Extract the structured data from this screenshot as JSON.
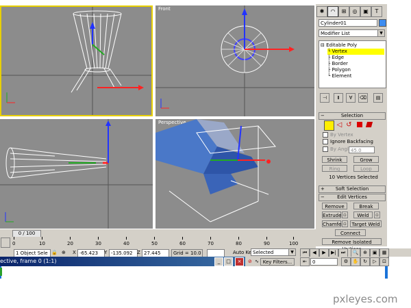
{
  "viewports": {
    "front_label": "Front",
    "perspective_label": "Perspective"
  },
  "panel": {
    "tabs": [
      "create-icon",
      "modify-icon",
      "hierarchy-icon",
      "motion-icon",
      "display-icon",
      "utilities-icon"
    ],
    "object_name": "Cylinder01",
    "modifier_list": "Modifier List",
    "stack": [
      "Editable Poly",
      "Vertex",
      "Edge",
      "Border",
      "Polygon",
      "Element"
    ],
    "selection": {
      "title": "Selection",
      "by_vertex": "By Vertex",
      "ignore_backfacing": "Ignore Backfacing",
      "by_angle": "By Angle:",
      "angle_value": "45.0",
      "shrink": "Shrink",
      "grow": "Grow",
      "ring": "Ring",
      "loop": "Loop",
      "status": "10 Vertices Selected"
    },
    "soft_selection": {
      "title": "Soft Selection"
    },
    "edit_vertices": {
      "title": "Edit Vertices",
      "remove": "Remove",
      "break": "Break",
      "extrude": "Extrude",
      "weld": "Weld",
      "chamfer": "Chamfer",
      "target_weld": "Target Weld",
      "connect": "Connect",
      "remove_isolated": "Remove Isolated Vertices"
    }
  },
  "timeline": {
    "frame_counter": "0 / 100",
    "ticks": [
      "0",
      "10",
      "20",
      "30",
      "40",
      "50",
      "60",
      "70",
      "80",
      "90",
      "100"
    ]
  },
  "status": {
    "object_selection": "1 Object Sele",
    "x_label": "X",
    "x_value": "-65.423",
    "y_label": "Y",
    "y_value": "-135.092",
    "z_label": "Z",
    "z_value": "27.445",
    "grid": "Grid = 10.0",
    "auto_key": "Auto Key",
    "set_key_mode": "Selected",
    "key_filters": "Key Filters...",
    "frame_field": "0"
  },
  "window": {
    "title": "ective, frame 0 (1:1)"
  },
  "watermark": "pxleyes.com"
}
